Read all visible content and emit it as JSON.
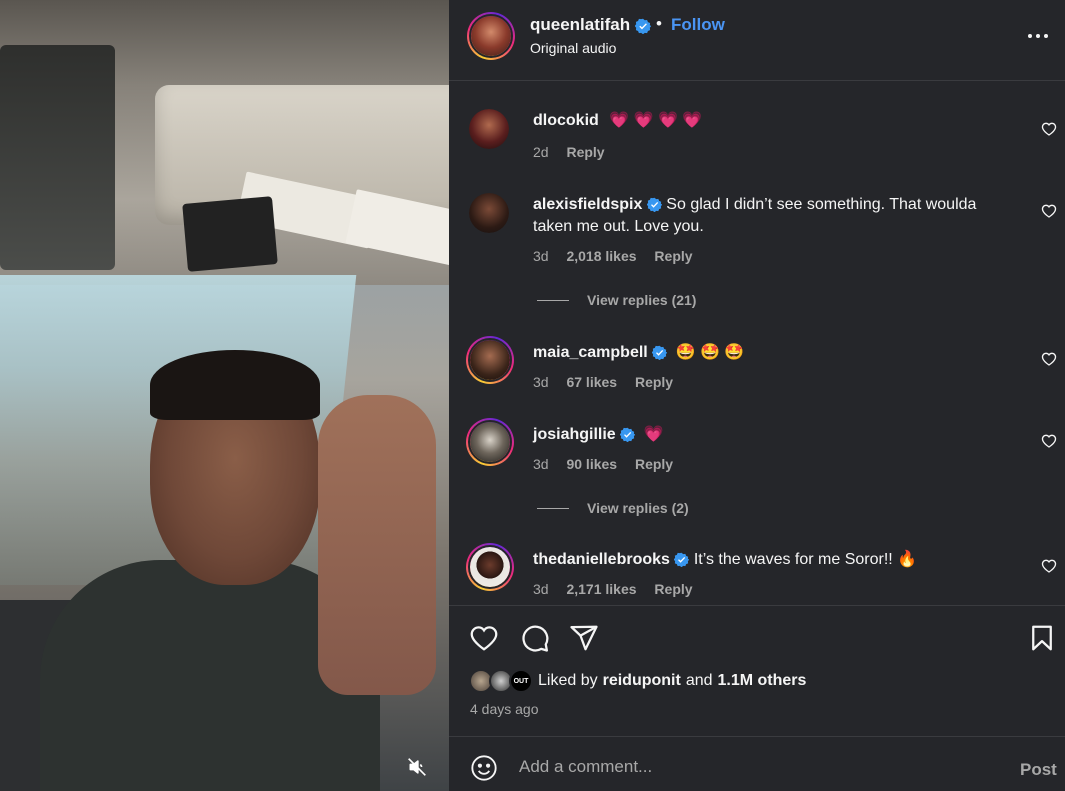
{
  "header": {
    "username": "queenlatifah",
    "separator": "•",
    "follow_label": "Follow",
    "audio_label": "Original audio"
  },
  "comments": [
    {
      "username": "dlocokid",
      "text": "💗 💗 💗 💗",
      "age": "2d",
      "likes": "",
      "reply": "Reply",
      "verified": false
    },
    {
      "username": "alexisfieldspix",
      "text": "So glad I didn’t see something. That woulda taken me out. Love you.",
      "age": "3d",
      "likes": "2,018 likes",
      "reply": "Reply",
      "verified": true,
      "view_replies": "View replies (21)"
    },
    {
      "username": "maia_campbell",
      "text": "🤩 🤩 🤩",
      "age": "3d",
      "likes": "67 likes",
      "reply": "Reply",
      "verified": true
    },
    {
      "username": "josiahgillie",
      "text": "💗",
      "age": "3d",
      "likes": "90 likes",
      "reply": "Reply",
      "verified": true,
      "view_replies": "View replies (2)"
    },
    {
      "username": "thedaniellebrooks",
      "text": "It’s the waves for me Soror!! 🔥",
      "age": "3d",
      "likes": "2,171 likes",
      "reply": "Reply",
      "verified": true
    }
  ],
  "liked_by": {
    "prefix": "Liked by",
    "user": "reiduponit",
    "connector": "and",
    "others": "1.1M others",
    "avatar_badge": "OUT"
  },
  "post_time": "4 days ago",
  "add_comment": {
    "placeholder": "Add a comment...",
    "post_label": "Post"
  },
  "colors": {
    "panel_bg": "#25262a",
    "link_blue": "#4a95f4",
    "verified_blue": "#3897f0",
    "muted_text": "#a8a8a8"
  },
  "icons": [
    "verified-icon",
    "more-icon",
    "heart-icon",
    "comment-icon",
    "share-icon",
    "bookmark-icon",
    "emoji-icon",
    "mute-icon"
  ]
}
